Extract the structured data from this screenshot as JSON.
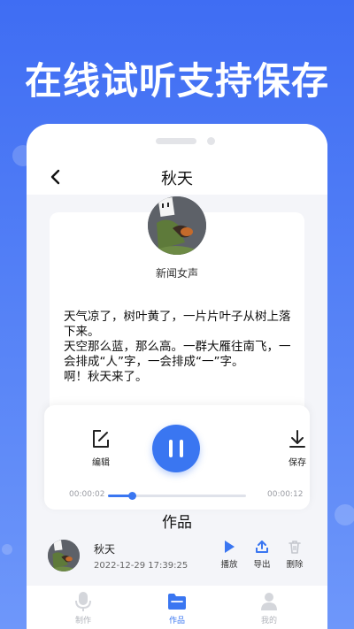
{
  "headline": "在线试听支持保存",
  "navbar": {
    "title": "秋天"
  },
  "voice": {
    "name": "新闻女声"
  },
  "article": {
    "paragraphs": [
      "天气凉了，树叶黄了，一片片叶子从树上落下来。",
      "天空那么蓝，那么高。一群大雁往南飞，一会排成“人”字，一会排成“一”字。",
      "啊！秋天来了。"
    ]
  },
  "player": {
    "edit_label": "编辑",
    "save_label": "保存",
    "current_time": "00:00:02",
    "total_time": "00:00:12",
    "progress": 0.17,
    "state": "playing"
  },
  "works": {
    "title": "作品",
    "items": [
      {
        "name": "秋天",
        "date": "2022-12-29 17:39:25",
        "play_label": "播放",
        "export_label": "导出",
        "delete_label": "删除"
      }
    ]
  },
  "tabbar": {
    "items": [
      {
        "label": "制作",
        "icon": "microphone-icon",
        "active": false
      },
      {
        "label": "作品",
        "icon": "folder-icon",
        "active": true
      },
      {
        "label": "我的",
        "icon": "user-icon",
        "active": false
      }
    ]
  },
  "colors": {
    "accent": "#3a76f1",
    "background_top": "#3f6df3",
    "background_bottom": "#6e97fa"
  }
}
